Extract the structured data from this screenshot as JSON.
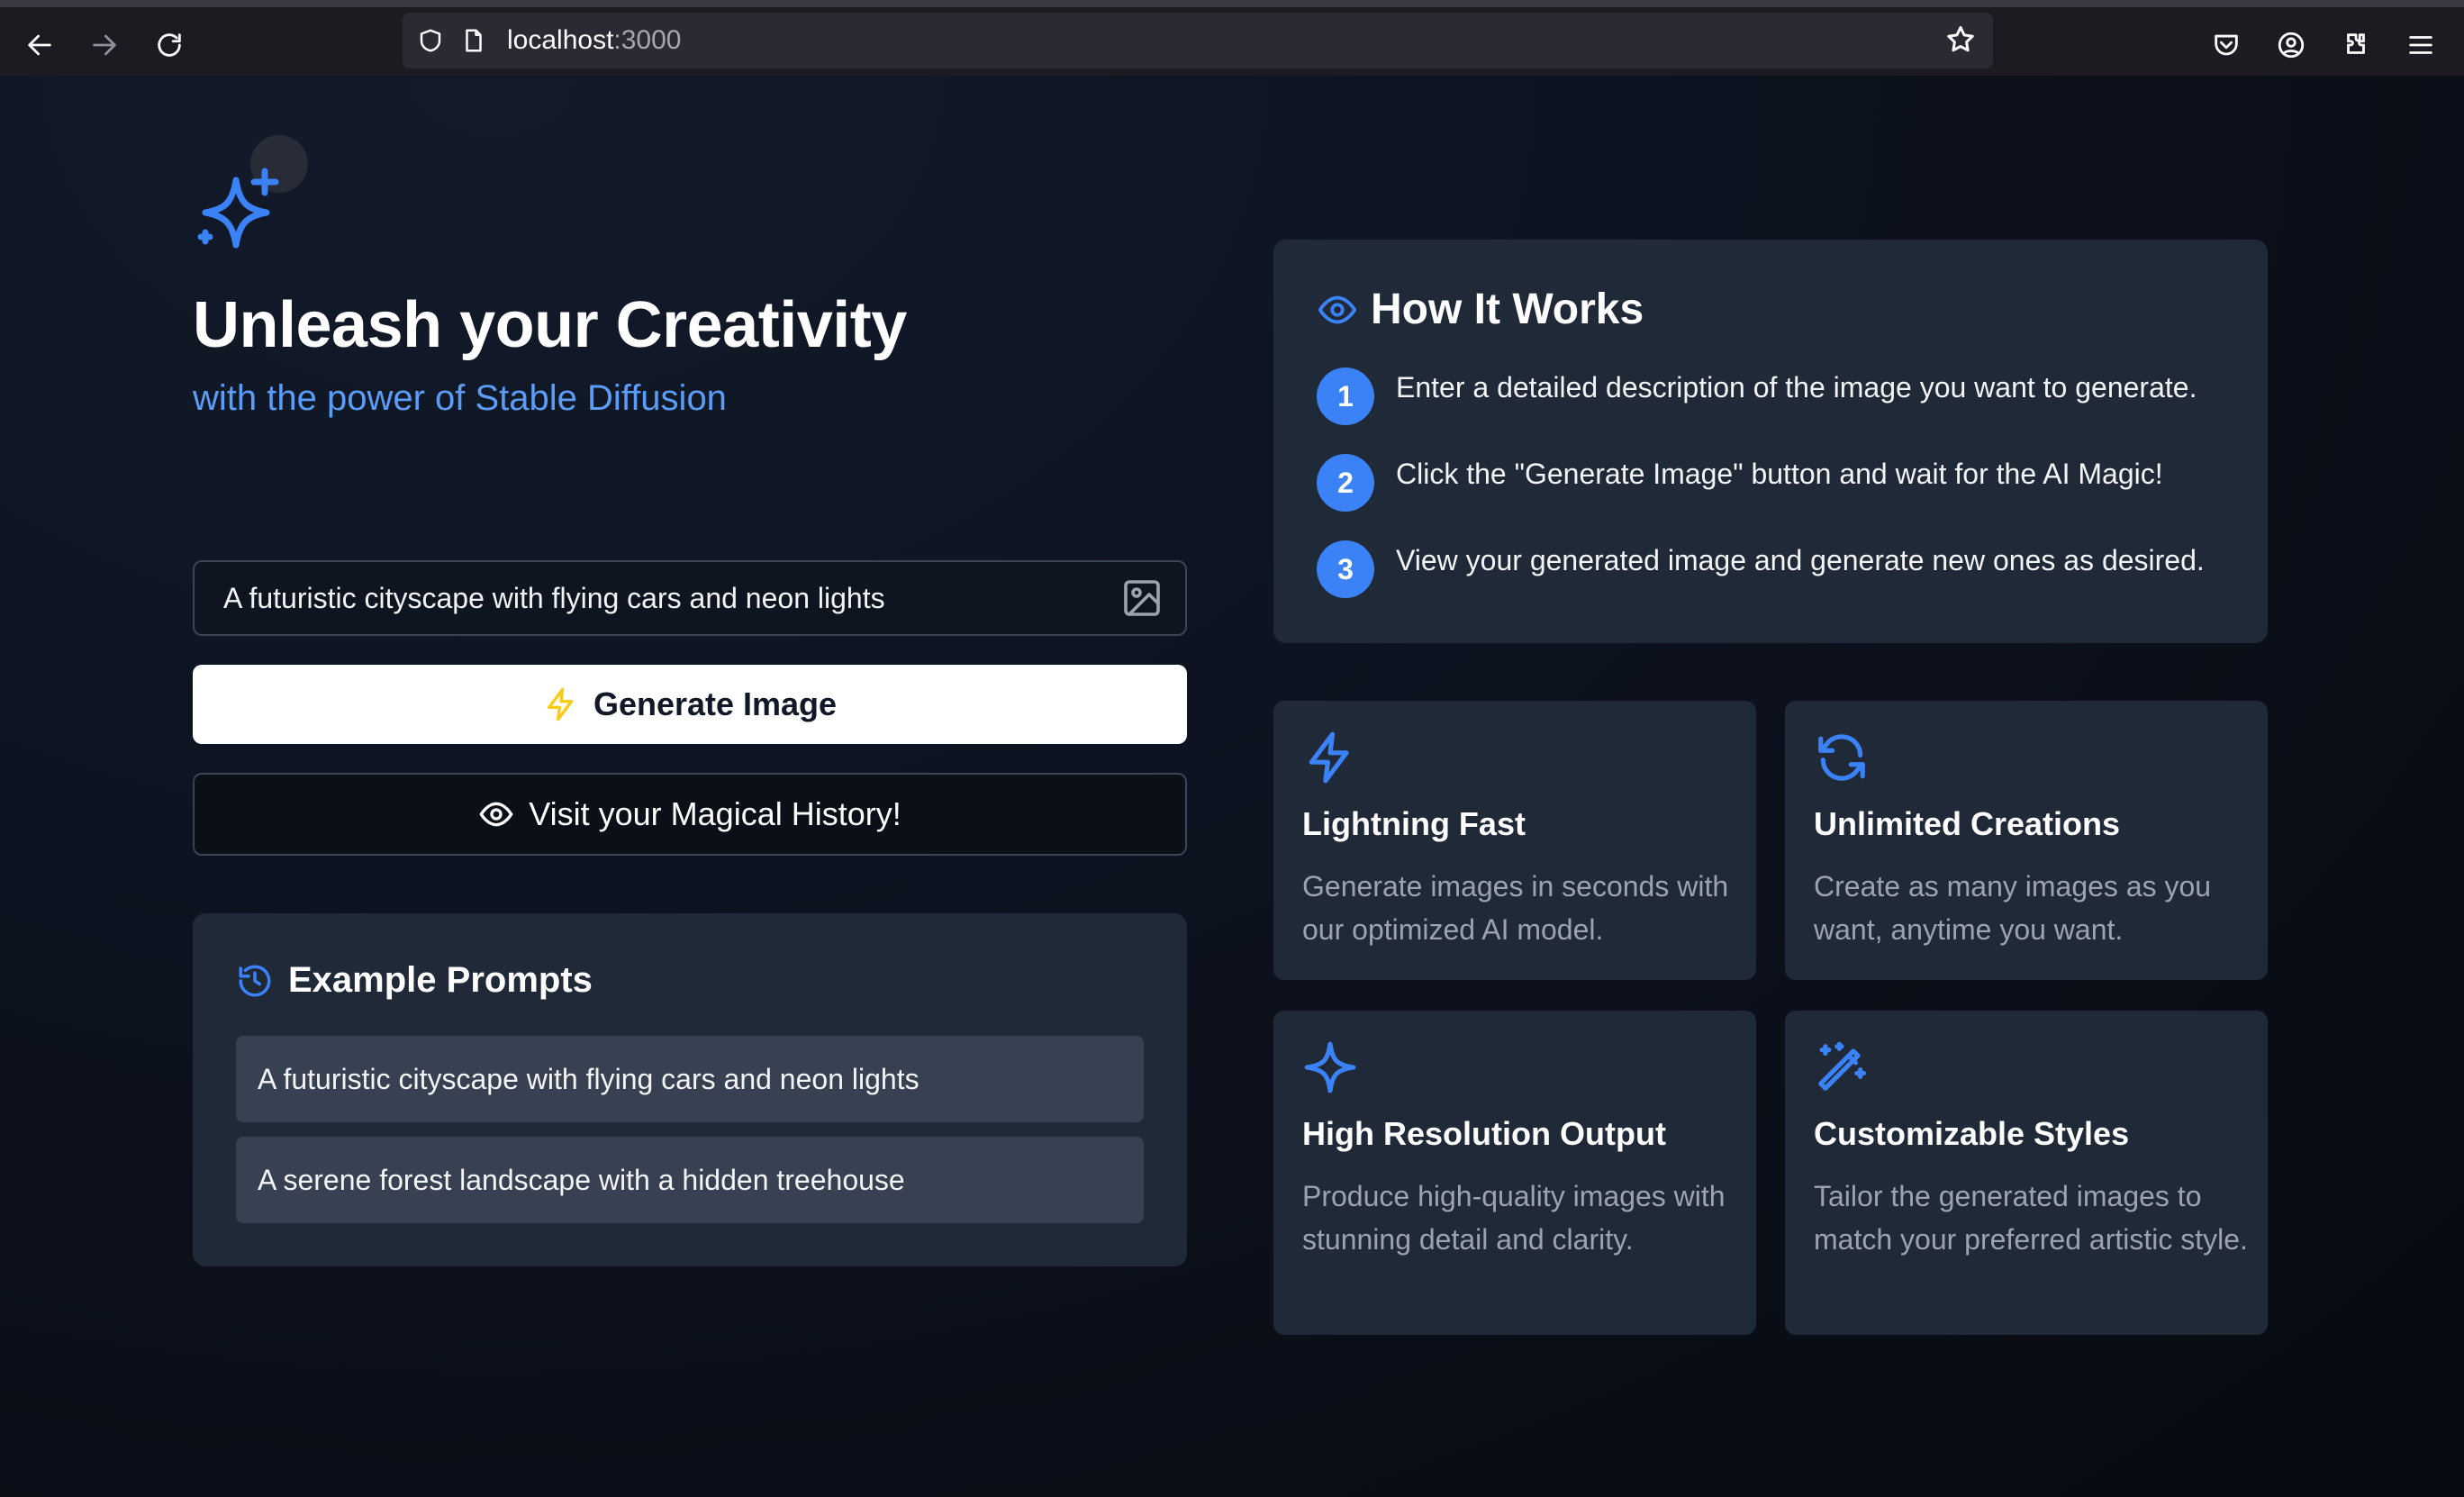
{
  "browser": {
    "url_host": "localhost",
    "url_port": ":3000"
  },
  "hero": {
    "title": "Unleash your Creativity",
    "subtitle": "with the power of Stable Diffusion"
  },
  "prompt": {
    "value": "A futuristic cityscape with flying cars and neon lights"
  },
  "buttons": {
    "generate": "Generate Image",
    "history": "Visit your Magical History!"
  },
  "examples": {
    "heading": "Example Prompts",
    "items": [
      "A futuristic cityscape with flying cars and neon lights",
      "A serene forest landscape with a hidden treehouse"
    ]
  },
  "how_it_works": {
    "heading": "How It Works",
    "steps": [
      {
        "num": "1",
        "text": "Enter a detailed description of the image you want to generate."
      },
      {
        "num": "2",
        "text": "Click the \"Generate Image\" button and wait for the AI Magic!"
      },
      {
        "num": "3",
        "text": "View your generated image and generate new ones as desired."
      }
    ]
  },
  "features": [
    {
      "icon": "lightning-icon",
      "title": "Lightning Fast",
      "desc": "Generate images in seconds with our optimized AI model."
    },
    {
      "icon": "refresh-icon",
      "title": "Unlimited Creations",
      "desc": "Create as many images as you want, anytime you want."
    },
    {
      "icon": "sparkle-icon",
      "title": "High Resolution Output",
      "desc": "Produce high-quality images with stunning detail and clarity."
    },
    {
      "icon": "magic-wand-icon",
      "title": "Customizable Styles",
      "desc": "Tailor the generated images to match your preferred artistic style."
    }
  ],
  "colors": {
    "accent": "#3b82f6",
    "accent_text": "#5b9cf6",
    "lightning": "#facc15",
    "card": "#1f2937"
  }
}
